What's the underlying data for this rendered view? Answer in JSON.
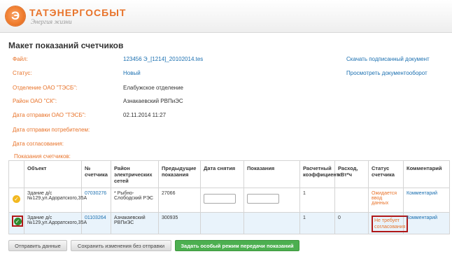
{
  "header": {
    "logo_letter": "Э",
    "company": "ТАТЭНЕРГОСБЫТ",
    "slogan": "Энергия жизни"
  },
  "page_title": "Макет показаний счетчиков",
  "fields": {
    "file_label": "Файл:",
    "file_value": "123456 Э_[1214]_20102014.tes",
    "status_label": "Статус:",
    "status_value": "Новый",
    "branch_label": "Отделение ОАО \"ТЭСБ\":",
    "branch_value": "Елабужское отделение",
    "district_label": "Район ОАО \"СК\":",
    "district_value": "Азнакаевский РВПиЭС",
    "sent_label": "Дата отправки ОАО \"ТЭСБ\":",
    "sent_value": "02.11.2014 11:27",
    "consumer_sent_label": "Дата отправки потребителем:",
    "consumer_sent_value": "",
    "agreed_label": "Дата согласования:",
    "agreed_value": ""
  },
  "links": {
    "download": "Скачать подписанный документ",
    "workflow": "Просмотреть документооборот"
  },
  "section_label": "Показания счетчиков:",
  "table": {
    "headers": {
      "object": "Объект",
      "number": "№ счетчика",
      "district": "Район электрических сетей",
      "prev": "Предыдущие показания",
      "date": "Дата снятия",
      "reading": "Показания",
      "coef": "Расчетный коэффициент",
      "consumption": "Расход, кВт*ч",
      "status": "Статус счетчика",
      "comment": "Комментарий"
    },
    "rows": [
      {
        "icon": "check-yellow-icon",
        "object": "Здание д/с №129,ул.Адоратского,35А",
        "number": "07030276",
        "district": "* Рыбно-Слободский РЭС",
        "prev": "27066",
        "date": "",
        "reading": "",
        "coef": "1",
        "consumption": "",
        "status": "Ожидается ввод данных",
        "comment": "Комментарий"
      },
      {
        "icon": "check-green-icon",
        "object": "Здание д/с №129,ул.Адоратского,35А",
        "number": "01103264",
        "district": "Азнакаевский РВПиЭС",
        "prev": "300935",
        "date": "",
        "reading": "",
        "coef": "1",
        "consumption": "0",
        "status": "Не требует согласования",
        "comment": "Комментарий"
      }
    ]
  },
  "buttons": {
    "send": "Отправить данные",
    "save": "Сохранить изменения без отправки",
    "special": "Задать особый режим передачи показаний"
  },
  "colors": {
    "accent_orange": "#e8732a",
    "link_blue": "#1a6fb0",
    "highlight_red": "#b01818",
    "button_green": "#4caf50"
  }
}
